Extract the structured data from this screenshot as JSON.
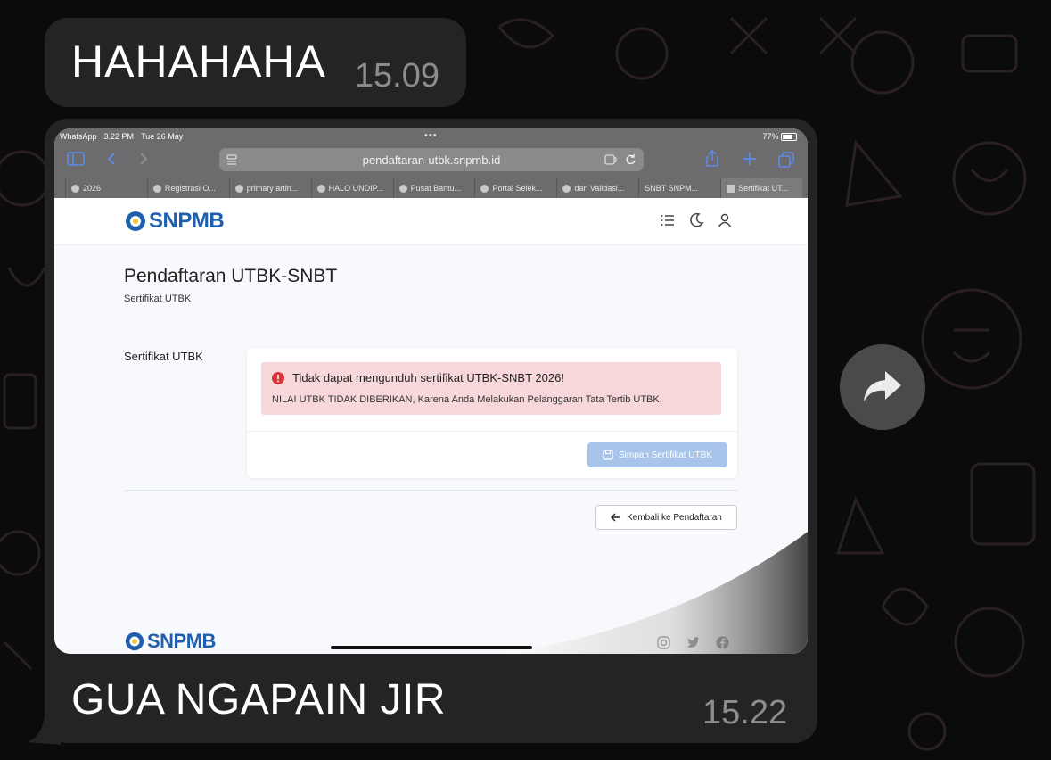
{
  "messages": {
    "top": {
      "text": "HAHAHAHA",
      "time": "15.09"
    },
    "main": {
      "caption": "GUA NGAPAIN JIR",
      "time": "15.22"
    }
  },
  "forward_button": {
    "icon": "share-forward-icon"
  },
  "screenshot": {
    "status": {
      "app": "WhatsApp",
      "time": "3.22 PM",
      "date": "Tue 26 May",
      "battery": "77%",
      "dots": "•••"
    },
    "url": "pendaftaran-utbk.snpmb.id",
    "tabs": [
      {
        "label": "2026"
      },
      {
        "label": "Registrasi O..."
      },
      {
        "label": "primary artin..."
      },
      {
        "label": "HALO UNDIP..."
      },
      {
        "label": "Pusat Bantu..."
      },
      {
        "label": "Portal Selek..."
      },
      {
        "label": "dan Validasi..."
      },
      {
        "label": "SNBT SNPM..."
      },
      {
        "label": "Sertifikat UT..."
      }
    ],
    "page": {
      "logo": "SNPMB",
      "title": "Pendaftaran UTBK-SNBT",
      "subtitle": "Sertifikat UTBK",
      "section_label": "Sertifikat UTBK",
      "alert_title": "Tidak dapat mengunduh sertifikat UTBK-SNBT 2026!",
      "alert_text": "NILAI UTBK TIDAK DIBERIKAN, Karena Anda Melakukan Pelanggaran Tata Tertib UTBK.",
      "save_button": "Simpan Sertifikat UTBK",
      "back_button": "Kembali ke Pendaftaran",
      "footer_logo": "SNPMB"
    }
  },
  "colors": {
    "bubble": "#242424",
    "alert_bg": "#f8d7da",
    "alert_icon": "#d9363e",
    "brand": "#1f5fab",
    "save_btn": "#a9c4eb"
  }
}
